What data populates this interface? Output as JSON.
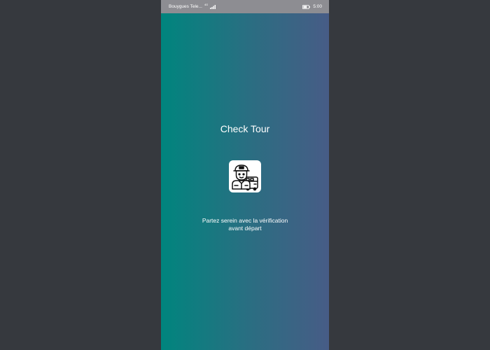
{
  "status_bar": {
    "carrier": "Bouygues Tele...",
    "network_type": "4G",
    "battery_icon": "battery-icon",
    "signal_icon": "signal-icon",
    "time": "5:00"
  },
  "app": {
    "title": "Check Tour",
    "logo_icon": "driver-with-bus-icon",
    "tagline_line1": "Partez serein avec la vérification",
    "tagline_line2": "avant départ"
  },
  "colors": {
    "gradient_start": "#00857e",
    "gradient_end": "#475c86",
    "status_bar": "#8d8d92",
    "outer_background": "#36393e"
  }
}
